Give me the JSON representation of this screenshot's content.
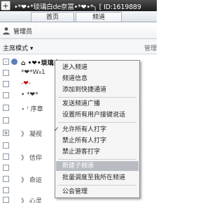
{
  "window": {
    "title": "•*❤•*琰璃白de奈冨•*❤•*╮ [ ID:1619889",
    "app_icon": "plus-icon"
  },
  "tabs": [
    {
      "label": "首页",
      "active": false
    },
    {
      "label": "频道",
      "active": true
    }
  ],
  "user": {
    "label": "管理员",
    "icon": "person-icon"
  },
  "mode": {
    "label": "主席模式",
    "dropdown_icon": "chevron-down-icon",
    "right_label": "管理"
  },
  "tree": [
    {
      "expander": "-",
      "text": "⌂ •❤•琰璃白de",
      "style": "bold"
    },
    {
      "expander": "",
      "text": "*❤*W₈1",
      "style": ""
    },
    {
      "expander": "",
      "text": "-❤-",
      "style": "red"
    },
    {
      "expander": "",
      "text": "• *❤*",
      "style": ""
    },
    {
      "expander": "",
      "text": "⋆ ⁽ 序章",
      "style": "dim"
    },
    {
      "expander": "",
      "text": "",
      "style": ""
    },
    {
      "expander": "+",
      "text": "》 凝视",
      "style": "dim"
    },
    {
      "expander": "",
      "text": "",
      "style": ""
    },
    {
      "expander": "",
      "text": "》 信仰",
      "style": "dim"
    },
    {
      "expander": "",
      "text": "",
      "style": ""
    },
    {
      "expander": "",
      "text": "》 命运",
      "style": "dim"
    },
    {
      "expander": "",
      "text": "",
      "style": ""
    },
    {
      "expander": "",
      "text": "》 心灵",
      "style": "dim"
    }
  ],
  "context_menu": {
    "items": [
      {
        "label": "进入频道",
        "checked": false,
        "highlight": false
      },
      {
        "label": "频道信息",
        "checked": false,
        "highlight": false
      },
      {
        "label": "添加到快捷通道",
        "checked": false,
        "highlight": false
      },
      {
        "label": "发送频道广播",
        "checked": false,
        "highlight": false
      },
      {
        "label": "设置所有用户接键说话",
        "checked": false,
        "highlight": false
      },
      {
        "label": "允许所有人打字",
        "checked": true,
        "highlight": false
      },
      {
        "label": "禁止所有人打字",
        "checked": false,
        "highlight": false
      },
      {
        "label": "禁止游客打字",
        "checked": false,
        "highlight": false
      },
      {
        "label": "新建子频道",
        "checked": false,
        "highlight": true
      },
      {
        "label": "批量调度至我所在频道",
        "checked": false,
        "highlight": false
      },
      {
        "label": "公会管理",
        "checked": false,
        "highlight": false
      }
    ]
  }
}
